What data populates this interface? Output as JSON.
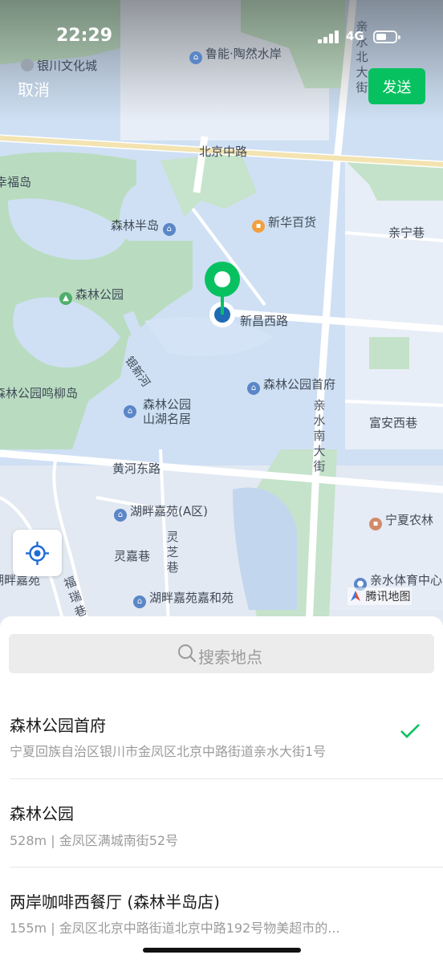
{
  "status_bar": {
    "time": "22:29",
    "network": "4G"
  },
  "header": {
    "cancel_label": "取消",
    "send_label": "发送"
  },
  "map": {
    "labels": {
      "yinchuan_culture_city": "银川文化城",
      "luneng_taoran": "鲁能·陶然水岸",
      "beijing_middle_road": "北京中路",
      "xingfu_partial": "幸福岛",
      "senlin_bandao": "森林半岛",
      "xinhua_baihuo": "新华百货",
      "qinning_lane": "亲宁巷",
      "senlin_park": "森林公园",
      "xinchang_west_road": "新昌西路",
      "senlin_park_shoufu": "森林公园首府",
      "yinxin_canal": "银新河",
      "senlin_park_minglidao": "森林公园鸣柳岛",
      "senlin_park_shanhu_line1": "森林公园",
      "senlin_park_shanhu_line2": "山湖名居",
      "fuan_west_lane": "富安西巷",
      "huanghe_east_road": "黄河东路",
      "hupan_jiayuan_a": "湖畔嘉苑(A区)",
      "ningxia_nonglin": "宁夏农林",
      "lingjia_lane": "灵嘉巷",
      "hupan_jiayuan_left": "湖畔嘉苑",
      "hupan_jiayuan_jiahe": "湖畔嘉苑嘉和苑",
      "qinshui_sports": "亲水体育中心",
      "fuan_partial": "福瑞巷"
    },
    "vertical_labels": {
      "qinshui_north_street": "亲水北大街",
      "qinshui_south_street": "亲水南大街",
      "lingzhi_lane": "灵芝巷",
      "fuan_lane": "福瑞巷"
    },
    "brand": "腾讯地图",
    "icons": {
      "pin": "location-pin-icon",
      "locate": "crosshair-icon",
      "search": "search-icon",
      "check": "checkmark-icon"
    },
    "accent_color": "#07c160"
  },
  "search": {
    "placeholder": "搜索地点"
  },
  "results": [
    {
      "name": "森林公园首府",
      "detail": "宁夏回族自治区银川市金凤区北京中路街道亲水大街1号",
      "selected": true
    },
    {
      "name": "森林公园",
      "detail": "528m | 金凤区满城南街52号",
      "selected": false
    },
    {
      "name": "两岸咖啡西餐厅 (森林半岛店)",
      "detail": "155m | 金凤区北京中路街道北京中路192号物美超市的...",
      "selected": false
    }
  ]
}
